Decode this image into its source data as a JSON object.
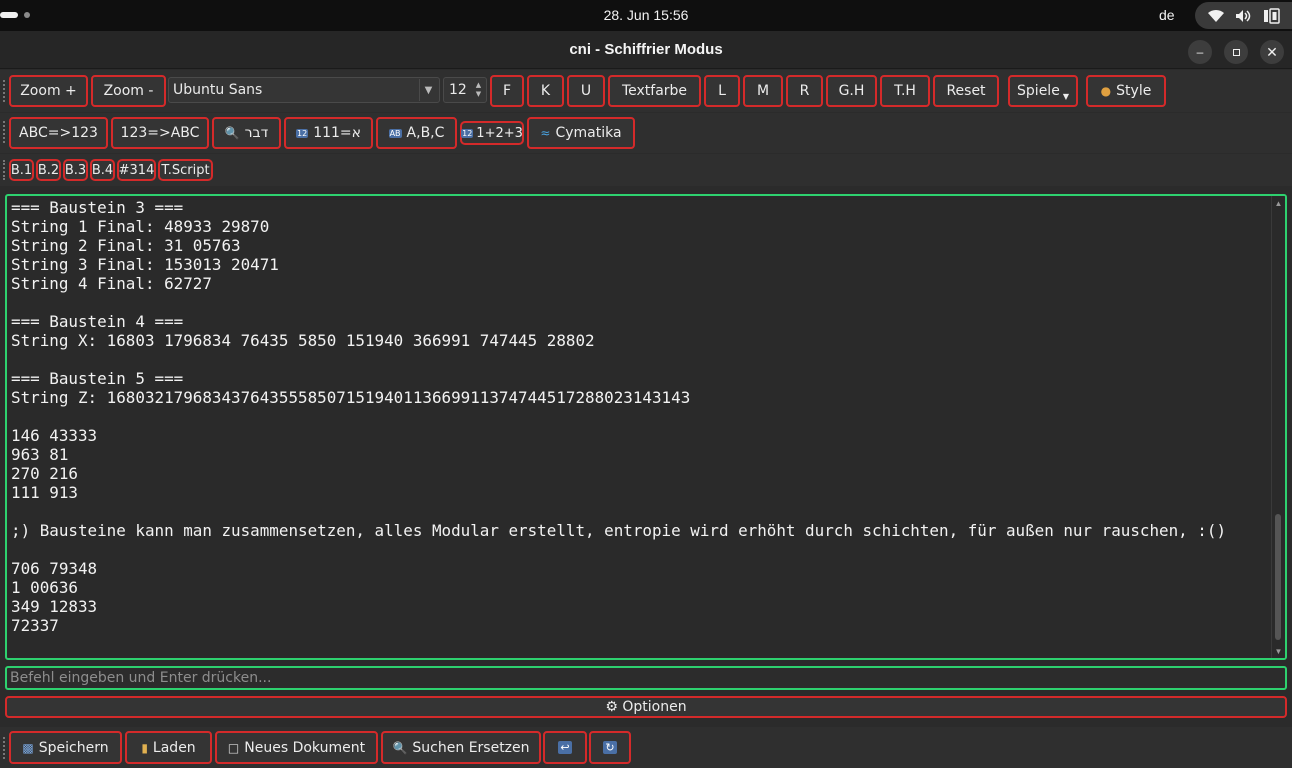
{
  "topbar": {
    "clock": "28. Jun  15:56",
    "language": "de",
    "icons": [
      "wifi-icon",
      "volume-icon",
      "battery-icon"
    ]
  },
  "window": {
    "title": "cni - Schiffrier Modus",
    "controls": [
      "minimize",
      "maximize",
      "close"
    ]
  },
  "toolbar1": {
    "zoom_in": "Zoom +",
    "zoom_out": "Zoom -",
    "font_family": "Ubuntu Sans",
    "font_size": "12",
    "buttons": [
      "F",
      "K",
      "U",
      "Textfarbe",
      "L",
      "M",
      "R",
      "G.H",
      "T.H",
      "Reset"
    ],
    "spiele": "Spiele",
    "style": "Style"
  },
  "toolbar2": {
    "abc_to_num": "ABC=>123",
    "num_to_abc": "123=>ABC",
    "dabar": "דבר",
    "aleph": "111=א",
    "letters": "A,B,C",
    "sum": "1+2+3",
    "cymatika": "Cymatika"
  },
  "toolbar3": {
    "buttons": [
      "B.1",
      "B.2",
      "B.3",
      "B.4",
      "#314",
      "T.Script"
    ]
  },
  "editor": {
    "lines": [
      "=== Baustein 3 ===",
      "String 1 Final: 48933 29870",
      "String 2 Final: 31 05763",
      "String 3 Final: 153013 20471",
      "String 4 Final: 62727",
      "",
      "=== Baustein 4 ===",
      "String X: 16803 1796834 76435 5850 151940 366991 747445 28802",
      "",
      "=== Baustein 5 ===",
      "String Z: 1680321796834376435558507151940113669911374744517288023143143",
      "",
      "146 43333",
      "963 81",
      "270 216",
      "111 913",
      "",
      ";) Bausteine kann man zusammensetzen, alles Modular erstellt, entropie wird erhöht durch schichten, für außen nur rauschen, :()",
      "",
      "706 79348",
      "1 00636",
      "349 12833",
      "72337"
    ]
  },
  "command": {
    "placeholder": "Befehl eingeben und Enter drücken..."
  },
  "options_label": "⚙ Optionen",
  "bottom_toolbar": {
    "save": "Speichern",
    "load": "Laden",
    "new_document": "Neues Dokument",
    "search_replace": "Suchen  Ersetzen"
  },
  "colors": {
    "button_border": "#d42a2a",
    "editor_border": "#2ed16f",
    "background": "#2b2b2b"
  }
}
